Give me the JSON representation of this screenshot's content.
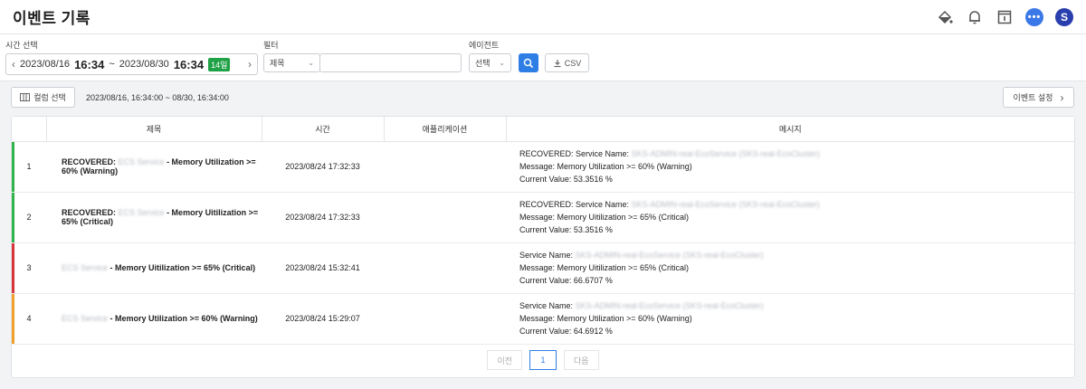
{
  "header": {
    "title": "이벤트 기록",
    "icons": [
      "paint-bucket-icon",
      "bell-icon",
      "info-panel-icon",
      "chat-icon"
    ],
    "chat_badge": "•••",
    "avatar_initial": "S"
  },
  "filters": {
    "time_label": "시간 선택",
    "time_from_date": "2023/08/16",
    "time_from_time": "16:34",
    "time_sep": "~",
    "time_to_date": "2023/08/30",
    "time_to_time": "16:34",
    "days_badge": "14일",
    "filter_label": "필터",
    "filter_select": "제목",
    "filter_input_value": "",
    "agent_label": "에이전트",
    "agent_select": "선택",
    "csv_label": "CSV"
  },
  "toolbar": {
    "column_select": "컬럼 선택",
    "range_text": "2023/08/16, 16:34:00 ~ 08/30, 16:34:00",
    "event_settings": "이벤트 설정"
  },
  "table": {
    "columns": [
      "제목",
      "시간",
      "애플리케이션",
      "메시지"
    ],
    "rows": [
      {
        "num": "1",
        "status_color": "#2fb34a",
        "title_prefix": "RECOVERED:",
        "title_blur": "ECS Service",
        "title_rest": " - Memory Utilization >= 60% (Warning)",
        "time": "2023/08/24 17:32:33",
        "app": "",
        "msg1_prefix": "RECOVERED: Service Name: ",
        "msg1_blur": "SKS-ADMIN-real-EcoService (SKS-real-EcoCluster)",
        "msg2": "Message: Memory Utilization >= 60% (Warning)",
        "msg3": "Current Value: 53.3516 %"
      },
      {
        "num": "2",
        "status_color": "#2fb34a",
        "title_prefix": "RECOVERED:",
        "title_blur": "ECS Service",
        "title_rest": " - Memory Uitilization >= 65% (Critical)",
        "time": "2023/08/24 17:32:33",
        "app": "",
        "msg1_prefix": "RECOVERED: Service Name: ",
        "msg1_blur": "SKS-ADMIN-real-EcoService (SKS-real-EcoCluster)",
        "msg2": "Message: Memory Uitilization >= 65% (Critical)",
        "msg3": "Current Value: 53.3516 %"
      },
      {
        "num": "3",
        "status_color": "#d9353b",
        "title_prefix": "",
        "title_blur": "ECS Service",
        "title_rest": " - Memory Uitilization >= 65% (Critical)",
        "time": "2023/08/24 15:32:41",
        "app": "",
        "msg1_prefix": "Service Name: ",
        "msg1_blur": "SKS-ADMIN-real-EcoService (SKS-real-EcoCluster)",
        "msg2": "Message: Memory Uitilization >= 65% (Critical)",
        "msg3": "Current Value: 66.6707 %"
      },
      {
        "num": "4",
        "status_color": "#f0a02b",
        "title_prefix": "",
        "title_blur": "ECS Service",
        "title_rest": " - Memory Utilization >= 60% (Warning)",
        "time": "2023/08/24 15:29:07",
        "app": "",
        "msg1_prefix": "Service Name: ",
        "msg1_blur": "SKS-ADMIN-real-EcoService (SKS-real-EcoCluster)",
        "msg2": "Message: Memory Utilization >= 60% (Warning)",
        "msg3": "Current Value: 64.6912 %"
      }
    ]
  },
  "pagination": {
    "prev": "이전",
    "current": "1",
    "next": "다음"
  }
}
